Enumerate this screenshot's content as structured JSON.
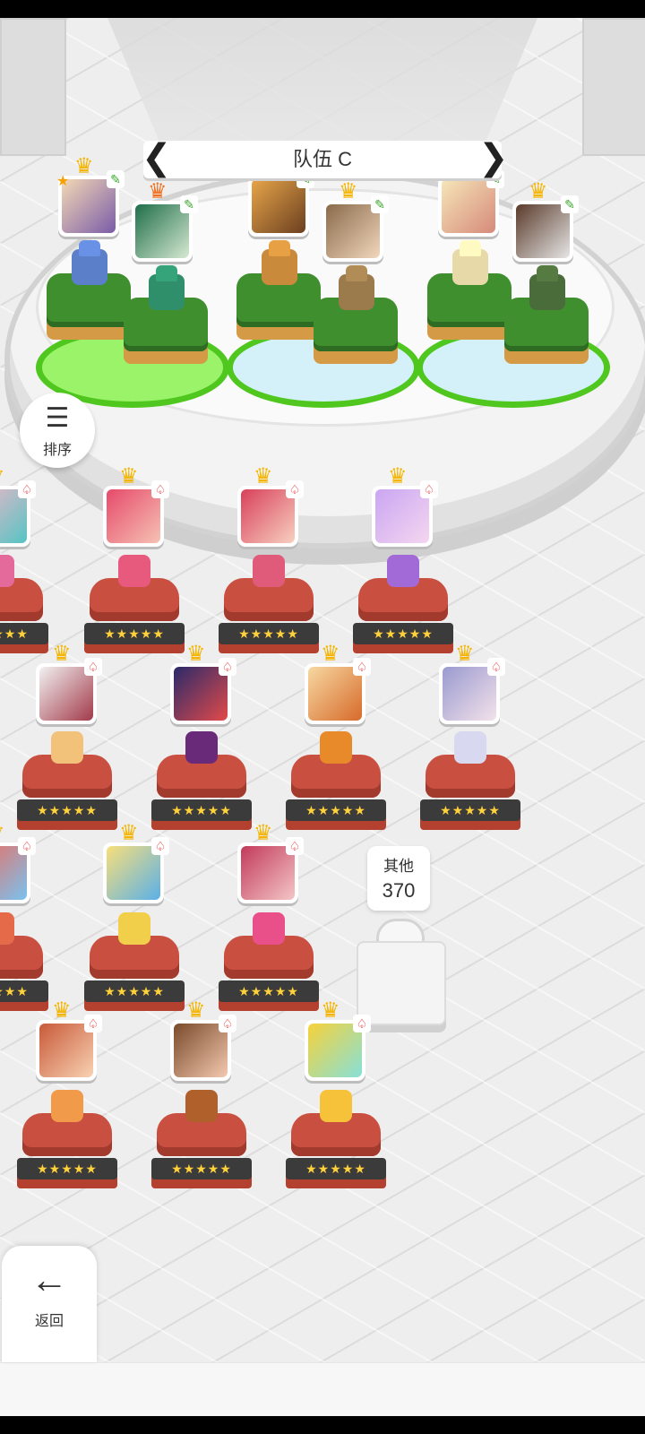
{
  "team": {
    "title": "队伍 C",
    "prev_glyph": "❮",
    "next_glyph": "❯"
  },
  "sort": {
    "icon": "sort-icon",
    "glyph": "☰",
    "label": "排序"
  },
  "back": {
    "icon": "back-arrow-icon",
    "glyph": "←",
    "label": "返回"
  },
  "others": {
    "label": "其他",
    "count": "370"
  },
  "rating": "★★★★★",
  "icons": {
    "crown": "♛",
    "spade_tag": "♤",
    "leaf_tag": "✎",
    "star_badge": "★"
  },
  "colors": {
    "crown": "#f4b400",
    "pedestal": "#c94f41",
    "slot_ring": "#4fc71f",
    "tag_red": "#e02020",
    "tag_green": "#3aa82b"
  }
}
